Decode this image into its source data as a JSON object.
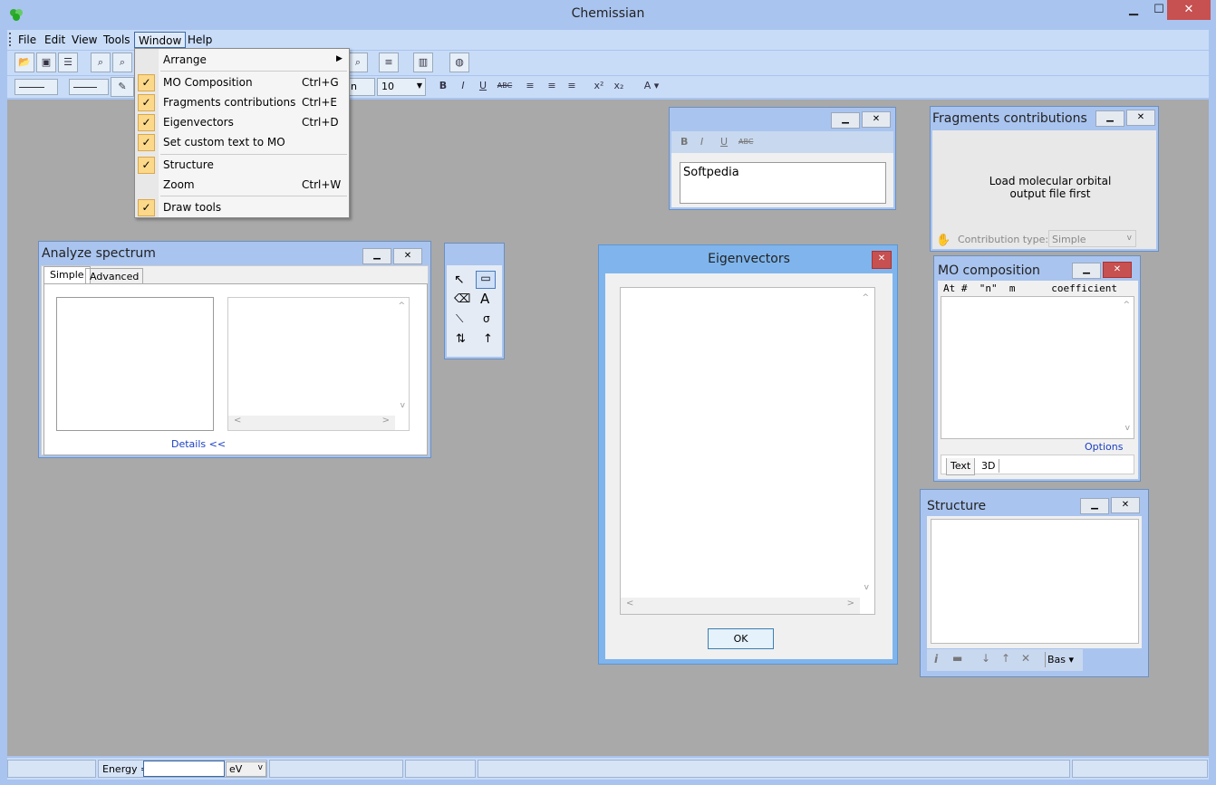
{
  "app": {
    "title": "Chemissian"
  },
  "menu": {
    "file": "File",
    "edit": "Edit",
    "view": "View",
    "tools": "Tools",
    "window": "Window",
    "help": "Help"
  },
  "window_menu": {
    "arrange": "Arrange",
    "mo_composition": "MO Composition",
    "mo_composition_sc": "Ctrl+G",
    "fragments": "Fragments contributions",
    "fragments_sc": "Ctrl+E",
    "eigenvectors": "Eigenvectors",
    "eigenvectors_sc": "Ctrl+D",
    "custom_text": "Set custom text to MO",
    "structure": "Structure",
    "zoom": "Zoom",
    "zoom_sc": "Ctrl+W",
    "draw_tools": "Draw tools"
  },
  "toolbar": {
    "font_size": "10",
    "format_bold": "B",
    "format_italic": "I",
    "format_underline": "U",
    "format_strike": "ABC"
  },
  "analyze": {
    "title": "Analyze spectrum",
    "tab_simple": "Simple",
    "tab_advanced": "Advanced",
    "details": "Details <<"
  },
  "textpanel": {
    "text": "Softpedia"
  },
  "fragments_win": {
    "title": "Fragments contributions",
    "message": "Load molecular orbital output file first",
    "contrib_label": "Contribution type:",
    "contrib_value": "Simple"
  },
  "mo_win": {
    "title": "MO composition",
    "header": "At #  \"n\"  m      coefficient",
    "options": "Options >>",
    "tab_text": "Text",
    "tab_3d": "3D"
  },
  "eigen_win": {
    "title": "Eigenvectors",
    "ok": "OK"
  },
  "structure_win": {
    "title": "Structure",
    "bas": "Bas"
  },
  "status": {
    "energy_label": "Energy =",
    "unit": "eV"
  }
}
